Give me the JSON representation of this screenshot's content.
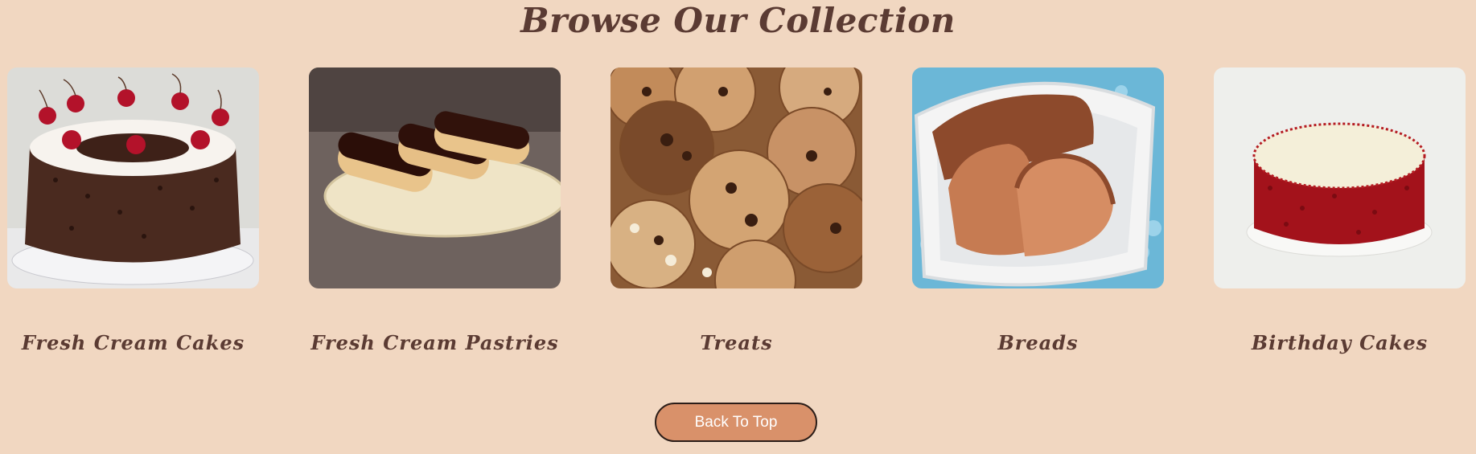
{
  "section": {
    "title": "Browse Our Collection"
  },
  "categories": [
    {
      "label": "Fresh Cream Cakes",
      "icon": "black-forest-cake-image"
    },
    {
      "label": "Fresh Cream Pastries",
      "icon": "eclairs-image"
    },
    {
      "label": "Treats",
      "icon": "cookies-image"
    },
    {
      "label": "Breads",
      "icon": "bread-loaf-image"
    },
    {
      "label": "Birthday Cakes",
      "icon": "red-velvet-birthday-cake-image"
    }
  ],
  "back_to_top": {
    "label": "Back To Top"
  },
  "colors": {
    "background": "#f1d7c1",
    "heading": "#5b3b33",
    "button": "#d9916a"
  }
}
